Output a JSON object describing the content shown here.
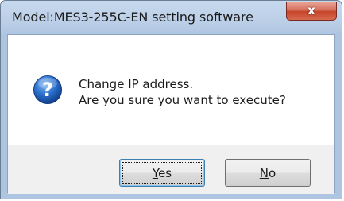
{
  "window": {
    "title": "Model:MES3-255C-EN setting software",
    "close_glyph": "x"
  },
  "dialog": {
    "icon": "question-icon",
    "message_line1": "Change IP address.",
    "message_line2": "Are you sure you want to execute?"
  },
  "buttons": {
    "yes": {
      "mnemonic": "Y",
      "rest": "es"
    },
    "no": {
      "mnemonic": "N",
      "rest": "o"
    }
  },
  "colors": {
    "titlebar": "#b9cde6",
    "close_button": "#c7442c",
    "icon_blue": "#1f5fb8",
    "button_bar": "#f0f0f0"
  }
}
